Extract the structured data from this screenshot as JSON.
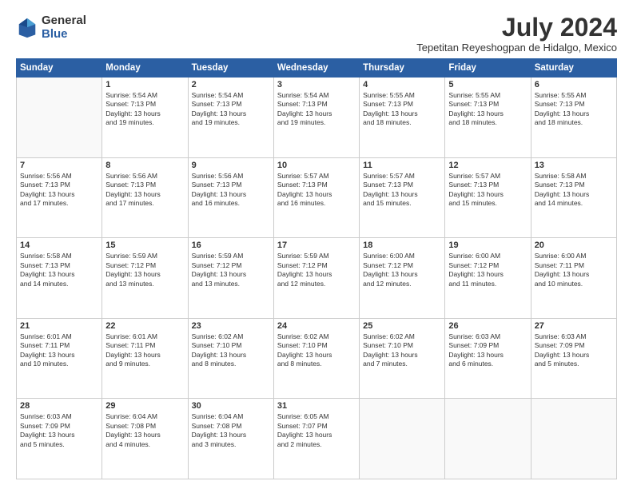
{
  "logo": {
    "general": "General",
    "blue": "Blue"
  },
  "title": "July 2024",
  "location": "Tepetitan Reyeshogpan de Hidalgo, Mexico",
  "headers": [
    "Sunday",
    "Monday",
    "Tuesday",
    "Wednesday",
    "Thursday",
    "Friday",
    "Saturday"
  ],
  "weeks": [
    [
      {
        "day": "",
        "info": ""
      },
      {
        "day": "1",
        "info": "Sunrise: 5:54 AM\nSunset: 7:13 PM\nDaylight: 13 hours\nand 19 minutes."
      },
      {
        "day": "2",
        "info": "Sunrise: 5:54 AM\nSunset: 7:13 PM\nDaylight: 13 hours\nand 19 minutes."
      },
      {
        "day": "3",
        "info": "Sunrise: 5:54 AM\nSunset: 7:13 PM\nDaylight: 13 hours\nand 19 minutes."
      },
      {
        "day": "4",
        "info": "Sunrise: 5:55 AM\nSunset: 7:13 PM\nDaylight: 13 hours\nand 18 minutes."
      },
      {
        "day": "5",
        "info": "Sunrise: 5:55 AM\nSunset: 7:13 PM\nDaylight: 13 hours\nand 18 minutes."
      },
      {
        "day": "6",
        "info": "Sunrise: 5:55 AM\nSunset: 7:13 PM\nDaylight: 13 hours\nand 18 minutes."
      }
    ],
    [
      {
        "day": "7",
        "info": "Sunrise: 5:56 AM\nSunset: 7:13 PM\nDaylight: 13 hours\nand 17 minutes."
      },
      {
        "day": "8",
        "info": "Sunrise: 5:56 AM\nSunset: 7:13 PM\nDaylight: 13 hours\nand 17 minutes."
      },
      {
        "day": "9",
        "info": "Sunrise: 5:56 AM\nSunset: 7:13 PM\nDaylight: 13 hours\nand 16 minutes."
      },
      {
        "day": "10",
        "info": "Sunrise: 5:57 AM\nSunset: 7:13 PM\nDaylight: 13 hours\nand 16 minutes."
      },
      {
        "day": "11",
        "info": "Sunrise: 5:57 AM\nSunset: 7:13 PM\nDaylight: 13 hours\nand 15 minutes."
      },
      {
        "day": "12",
        "info": "Sunrise: 5:57 AM\nSunset: 7:13 PM\nDaylight: 13 hours\nand 15 minutes."
      },
      {
        "day": "13",
        "info": "Sunrise: 5:58 AM\nSunset: 7:13 PM\nDaylight: 13 hours\nand 14 minutes."
      }
    ],
    [
      {
        "day": "14",
        "info": "Sunrise: 5:58 AM\nSunset: 7:13 PM\nDaylight: 13 hours\nand 14 minutes."
      },
      {
        "day": "15",
        "info": "Sunrise: 5:59 AM\nSunset: 7:12 PM\nDaylight: 13 hours\nand 13 minutes."
      },
      {
        "day": "16",
        "info": "Sunrise: 5:59 AM\nSunset: 7:12 PM\nDaylight: 13 hours\nand 13 minutes."
      },
      {
        "day": "17",
        "info": "Sunrise: 5:59 AM\nSunset: 7:12 PM\nDaylight: 13 hours\nand 12 minutes."
      },
      {
        "day": "18",
        "info": "Sunrise: 6:00 AM\nSunset: 7:12 PM\nDaylight: 13 hours\nand 12 minutes."
      },
      {
        "day": "19",
        "info": "Sunrise: 6:00 AM\nSunset: 7:12 PM\nDaylight: 13 hours\nand 11 minutes."
      },
      {
        "day": "20",
        "info": "Sunrise: 6:00 AM\nSunset: 7:11 PM\nDaylight: 13 hours\nand 10 minutes."
      }
    ],
    [
      {
        "day": "21",
        "info": "Sunrise: 6:01 AM\nSunset: 7:11 PM\nDaylight: 13 hours\nand 10 minutes."
      },
      {
        "day": "22",
        "info": "Sunrise: 6:01 AM\nSunset: 7:11 PM\nDaylight: 13 hours\nand 9 minutes."
      },
      {
        "day": "23",
        "info": "Sunrise: 6:02 AM\nSunset: 7:10 PM\nDaylight: 13 hours\nand 8 minutes."
      },
      {
        "day": "24",
        "info": "Sunrise: 6:02 AM\nSunset: 7:10 PM\nDaylight: 13 hours\nand 8 minutes."
      },
      {
        "day": "25",
        "info": "Sunrise: 6:02 AM\nSunset: 7:10 PM\nDaylight: 13 hours\nand 7 minutes."
      },
      {
        "day": "26",
        "info": "Sunrise: 6:03 AM\nSunset: 7:09 PM\nDaylight: 13 hours\nand 6 minutes."
      },
      {
        "day": "27",
        "info": "Sunrise: 6:03 AM\nSunset: 7:09 PM\nDaylight: 13 hours\nand 5 minutes."
      }
    ],
    [
      {
        "day": "28",
        "info": "Sunrise: 6:03 AM\nSunset: 7:09 PM\nDaylight: 13 hours\nand 5 minutes."
      },
      {
        "day": "29",
        "info": "Sunrise: 6:04 AM\nSunset: 7:08 PM\nDaylight: 13 hours\nand 4 minutes."
      },
      {
        "day": "30",
        "info": "Sunrise: 6:04 AM\nSunset: 7:08 PM\nDaylight: 13 hours\nand 3 minutes."
      },
      {
        "day": "31",
        "info": "Sunrise: 6:05 AM\nSunset: 7:07 PM\nDaylight: 13 hours\nand 2 minutes."
      },
      {
        "day": "",
        "info": ""
      },
      {
        "day": "",
        "info": ""
      },
      {
        "day": "",
        "info": ""
      }
    ]
  ]
}
